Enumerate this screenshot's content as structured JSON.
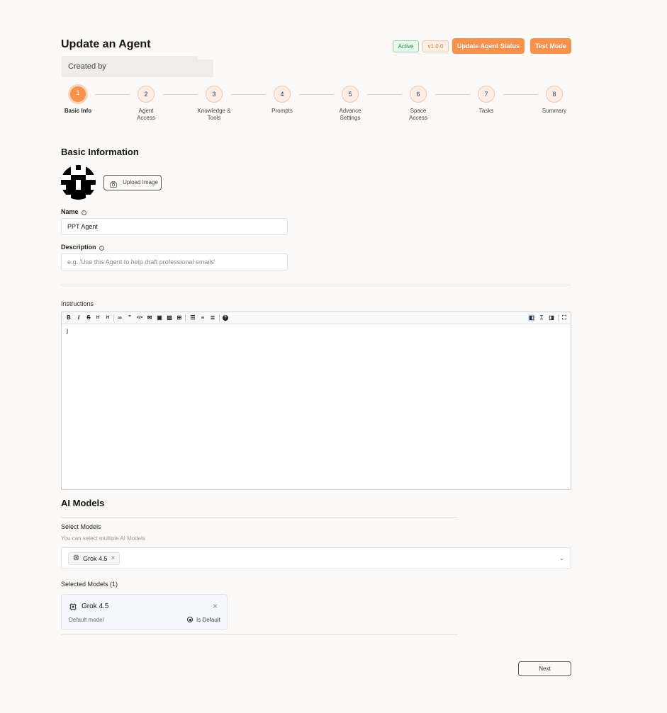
{
  "header": {
    "title": "Update an Agent",
    "created_by": "Created by",
    "status_badge": "Active",
    "version_badge": "v1.0.0",
    "update_status_button": "Update Agent Status",
    "test_mode_button": "Test Mode"
  },
  "steps": [
    {
      "number": "1",
      "label": "Basic Info",
      "active": true
    },
    {
      "number": "2",
      "label": "Agent Access"
    },
    {
      "number": "3",
      "label": "Knowledge & Tools"
    },
    {
      "number": "4",
      "label": "Prompts"
    },
    {
      "number": "5",
      "label": "Advance Settings"
    },
    {
      "number": "6",
      "label": "Space Access"
    },
    {
      "number": "7",
      "label": "Tasks"
    },
    {
      "number": "8",
      "label": "Summary"
    }
  ],
  "basic_info": {
    "heading": "Basic Information",
    "upload_button": "Upload Image",
    "name_label": "Name",
    "name_value": "PPT Agent",
    "description_label": "Description",
    "description_placeholder": "e.g. 'Use this Agent to help draft professional emails'"
  },
  "instructions": {
    "label": "Instructions",
    "content": "j"
  },
  "ai_models": {
    "heading": "AI Models",
    "select_label": "Select Models",
    "select_hint": "You can select multiple AI Models",
    "chip_label": "Grok 4.5",
    "selected_label": "Selected Models (1)",
    "card_model": "Grok 4.5",
    "card_default_text": "Default model",
    "card_is_default": "Is Default"
  },
  "footer": {
    "next_button": "Next"
  },
  "colors": {
    "accent": "#f8914a",
    "background": "#fbfaf8"
  }
}
